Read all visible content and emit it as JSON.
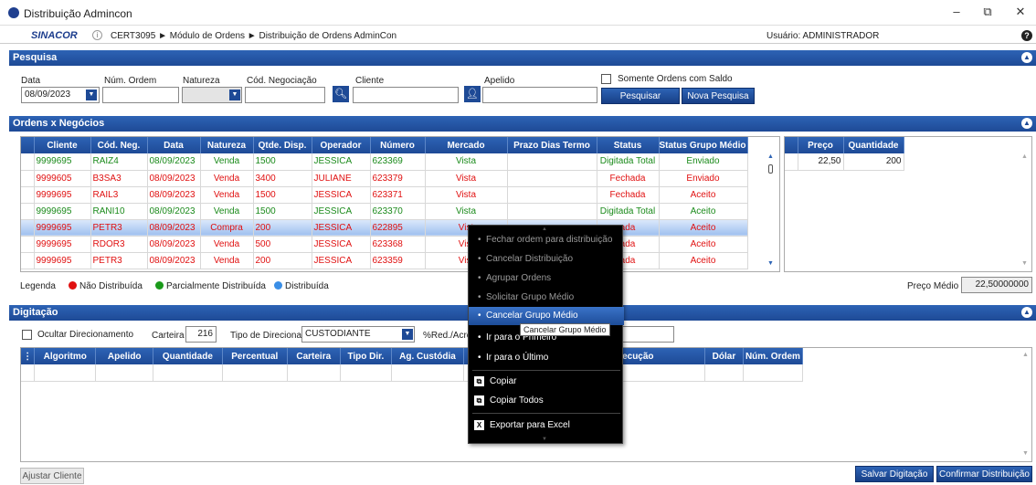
{
  "window": {
    "title": "Distribuição Admincon",
    "minimize": "–",
    "restore": "⧉",
    "close": "✕"
  },
  "topbar": {
    "brand": "SINACOR",
    "breadcrumb": "CERT3095 ► Módulo de Ordens ► Distribuição de Ordens AdminCon",
    "user": "Usuário: ADMINISTRADOR",
    "help": "?"
  },
  "pesquisa": {
    "title": "Pesquisa",
    "data_label": "Data",
    "data_value": "08/09/2023",
    "num_ordem_label": "Núm. Ordem",
    "natureza_label": "Natureza",
    "cod_neg_label": "Cód. Negociação",
    "cliente_label": "Cliente",
    "apelido_label": "Apelido",
    "saldo_label": "Somente Ordens com Saldo",
    "pesquisar": "Pesquisar",
    "nova": "Nova Pesquisa"
  },
  "ordens": {
    "title": "Ordens x Negócios",
    "columns": [
      "Cliente",
      "Cód. Neg.",
      "Data",
      "Natureza",
      "Qtde. Disp.",
      "Operador",
      "Número",
      "Mercado",
      "Prazo Dias Termo",
      "Status",
      "Status Grupo Médio ▼"
    ],
    "rows": [
      {
        "cliente": "9999695",
        "cod": "RAIZ4",
        "data": "08/09/2023",
        "natureza": "Venda",
        "qtde": "1500",
        "operador": "JESSICA",
        "numero": "623369",
        "mercado": "Vista",
        "prazo": "",
        "status": "Digitada Total",
        "grupo": "Enviado",
        "color": "green"
      },
      {
        "cliente": "9999605",
        "cod": "B3SA3",
        "data": "08/09/2023",
        "natureza": "Venda",
        "qtde": "3400",
        "operador": "JULIANE",
        "numero": "623379",
        "mercado": "Vista",
        "prazo": "",
        "status": "Fechada",
        "grupo": "Enviado",
        "color": "red"
      },
      {
        "cliente": "9999695",
        "cod": "RAIL3",
        "data": "08/09/2023",
        "natureza": "Venda",
        "qtde": "1500",
        "operador": "JESSICA",
        "numero": "623371",
        "mercado": "Vista",
        "prazo": "",
        "status": "Fechada",
        "grupo": "Aceito",
        "color": "red"
      },
      {
        "cliente": "9999695",
        "cod": "RANI10",
        "data": "08/09/2023",
        "natureza": "Venda",
        "qtde": "1500",
        "operador": "JESSICA",
        "numero": "623370",
        "mercado": "Vista",
        "prazo": "",
        "status": "Digitada Total",
        "grupo": "Aceito",
        "color": "green"
      },
      {
        "cliente": "9999695",
        "cod": "PETR3",
        "data": "08/09/2023",
        "natureza": "Compra",
        "qtde": "200",
        "operador": "JESSICA",
        "numero": "622895",
        "mercado": "Vist",
        "prazo": "",
        "status": "ada",
        "grupo": "Aceito",
        "color": "red"
      },
      {
        "cliente": "9999695",
        "cod": "RDOR3",
        "data": "08/09/2023",
        "natureza": "Venda",
        "qtde": "500",
        "operador": "JESSICA",
        "numero": "623368",
        "mercado": "Vist",
        "prazo": "",
        "status": "ada",
        "grupo": "Aceito",
        "color": "red"
      },
      {
        "cliente": "9999695",
        "cod": "PETR3",
        "data": "08/09/2023",
        "natureza": "Venda",
        "qtde": "200",
        "operador": "JESSICA",
        "numero": "623359",
        "mercado": "Vist",
        "prazo": "",
        "status": "ada",
        "grupo": "Aceito",
        "color": "red"
      }
    ],
    "legend_label": "Legenda",
    "legend": [
      {
        "label": "Não Distribuída",
        "color": "#e01010"
      },
      {
        "label": "Parcialmente Distribuída",
        "color": "#1a9a1a"
      },
      {
        "label": "Distribuída",
        "color": "#3a8ee6"
      }
    ],
    "preco_cols": [
      "Preço",
      "Quantidade"
    ],
    "preco_rows": [
      {
        "preco": "22,50",
        "qtd": "200"
      }
    ],
    "preco_medio_label": "Preço Médio",
    "preco_medio_value": "22,50000000"
  },
  "digitacao": {
    "title": "Digitação",
    "ocultar": "Ocultar Direcionamento",
    "carteira_label": "Carteira",
    "carteira_value": "216",
    "tipo_label": "Tipo de Direcionamento",
    "tipo_value": "CUSTODIANTE",
    "red_label": "%Red./Acré",
    "columns": [
      "Algoritmo",
      "Apelido",
      "Quantidade",
      "Percentual",
      "Carteira",
      "Tipo Dir.",
      "Ag. Custódia",
      "Cli. Custód",
      "tagem Execução",
      "Dólar",
      "Núm. Ordem"
    ]
  },
  "bottom": {
    "ajustar": "Ajustar Cliente",
    "salvar": "Salvar Digitação",
    "confirmar": "Confirmar Distribuição"
  },
  "context_menu": {
    "items": [
      "Fechar ordem para distribuição",
      "Cancelar Distribuição",
      "Agrupar Ordens",
      "Solicitar Grupo Médio",
      "Cancelar Grupo Médio",
      "Ir para o Primeiro",
      "Ir para o Último",
      "Copiar",
      "Copiar Todos",
      "Exportar para Excel"
    ],
    "tooltip": "Cancelar Grupo Médio"
  }
}
